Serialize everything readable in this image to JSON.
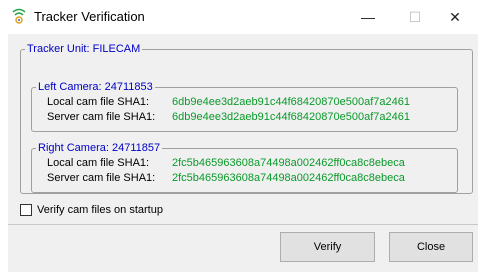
{
  "window": {
    "title": "Tracker Verification",
    "minimize": "—",
    "maximize": "☐",
    "close": "✕"
  },
  "tracker_group": {
    "legend": "Tracker Unit: FILECAM"
  },
  "left_camera": {
    "legend": "Left Camera: 24711853",
    "local_label": "Local cam file SHA1:",
    "local_value": "6db9e4ee3d2aeb91c44f68420870e500af7a2461",
    "server_label": "Server cam file SHA1:",
    "server_value": "6db9e4ee3d2aeb91c44f68420870e500af7a2461"
  },
  "right_camera": {
    "legend": "Right Camera: 24711857",
    "local_label": "Local cam file SHA1:",
    "local_value": "2fc5b465963608a74498a002462ff0ca8c8ebeca",
    "server_label": "Server cam file SHA1:",
    "server_value": "2fc5b465963608a74498a002462ff0ca8c8ebeca"
  },
  "options": {
    "verify_on_startup_label": "Verify cam files on startup",
    "verify_on_startup_checked": false
  },
  "buttons": {
    "verify": "Verify",
    "close": "Close"
  },
  "colors": {
    "legend": "#0000c8",
    "hash": "#0a9a2a"
  }
}
